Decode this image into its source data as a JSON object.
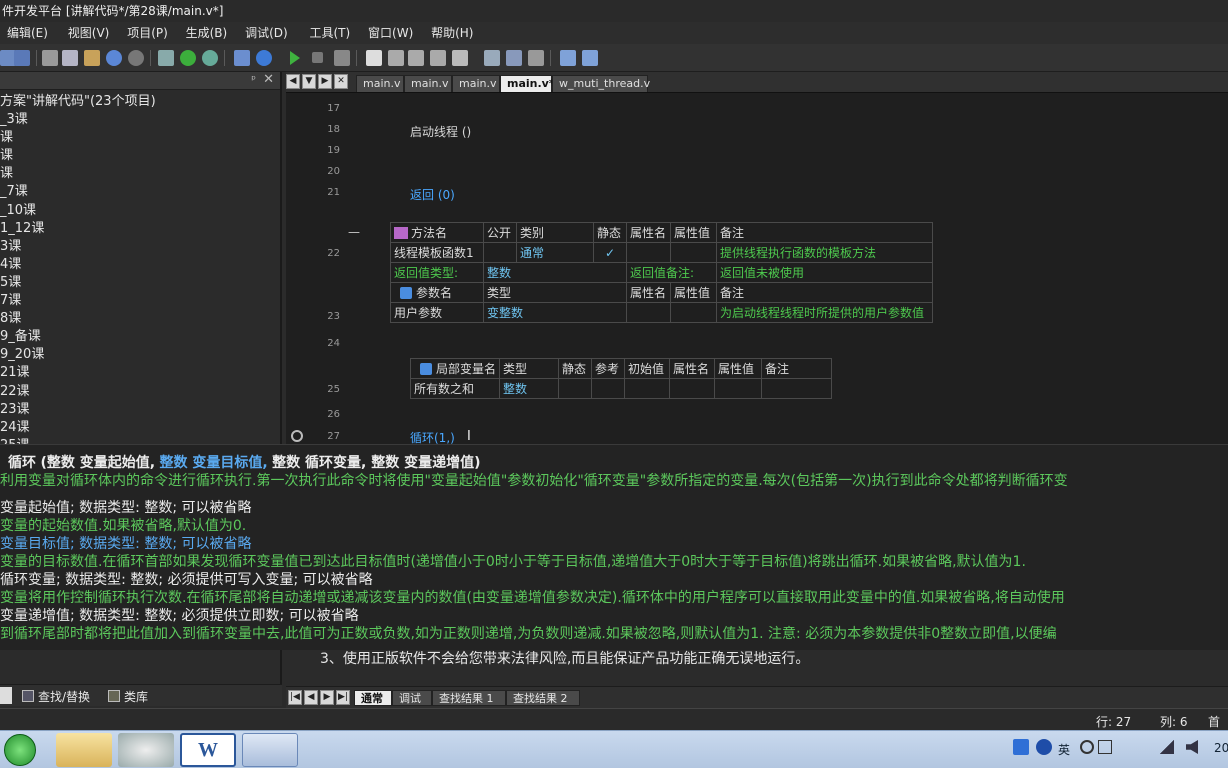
{
  "window": {
    "title": "件开发平台 [讲解代码*/第28课/main.v*]"
  },
  "menu": [
    "编辑(E)",
    "视图(V)",
    "项目(P)",
    "生成(B)",
    "调试(D)",
    "工具(T)",
    "窗口(W)",
    "帮助(H)"
  ],
  "solution_tree": {
    "items": [
      "方案\"讲解代码\"(23个项目)",
      "_3课",
      "课",
      "课",
      "课",
      "_7课",
      "_10课",
      "1_12课",
      "3课",
      "4课",
      "5课",
      "7课",
      "8课",
      "9_备课",
      "9_20课",
      "21课",
      "22课",
      "23课",
      "24课",
      "25课"
    ]
  },
  "left_tabs": [
    "查找/替换",
    "类库"
  ],
  "doc_tabs": {
    "items": [
      "main.v",
      "main.v",
      "main.v",
      "main.v*",
      "w_muti_thread.v"
    ],
    "active_index": 3
  },
  "editor": {
    "line17": "17",
    "line18": "18",
    "line18_code": "启动线程 ()",
    "line19": "19",
    "line20": "20",
    "line21": "21",
    "line21_code": "返回 (0)",
    "line22": "22",
    "line23": "23",
    "line24": "24",
    "line25": "25",
    "line26": "26",
    "line27": "27",
    "line27_code": "循环(1,)",
    "collapse_marker": "—",
    "cursor_glyph": "I",
    "method_table": {
      "headers": [
        "方法名",
        "公开",
        "类别",
        "静态",
        "属性名",
        "属性值",
        "备注"
      ],
      "row": [
        "线程模板函数1",
        "",
        "通常",
        "✓",
        "",
        "",
        "提供线程执行函数的模板方法"
      ],
      "return_type_label": "返回值类型:",
      "return_type": "整数",
      "return_note_label": "返回值备注:",
      "return_note": "返回值未被使用",
      "param_headers": [
        "参数名",
        "类型",
        "",
        "属性名",
        "属性值",
        "备注"
      ],
      "param_row": [
        "用户参数",
        "变整数",
        "",
        "",
        "",
        "为启动线程线程时所提供的用户参数值"
      ]
    },
    "local_table": {
      "headers": [
        "局部变量名",
        "类型",
        "静态",
        "参考",
        "初始值",
        "属性名",
        "属性值",
        "备注"
      ],
      "row": [
        "所有数之和",
        "整数",
        "",
        "",
        "",
        "",
        "",
        ""
      ]
    }
  },
  "help": {
    "signature_name": "循环",
    "signature_p1": "(整数 变量起始值,",
    "signature_p2": "整数 变量目标值,",
    "signature_p3": "整数 循环变量, 整数 变量递增值)",
    "desc": "利用变量对循环体内的命令进行循环执行.第一次执行此命令时将使用\"变量起始值\"参数初始化\"循环变量\"参数所指定的变量.每次(包括第一次)执行到此命令处都将判断循环变",
    "p1_title": "变量起始值; 数据类型: 整数; 可以被省略",
    "p1_desc": "变量的起始数值.如果被省略,默认值为0.",
    "p2_title": "变量目标值; 数据类型: 整数; 可以被省略",
    "p2_desc": "变量的目标数值.在循环首部如果发现循环变量值已到达此目标值时(递增值小于0时小于等于目标值,递增值大于0时大于等于目标值)将跳出循环.如果被省略,默认值为1.",
    "p3_title": "循环变量; 数据类型: 整数; 必须提供可写入变量; 可以被省略",
    "p3_desc": "变量将用作控制循环执行次数.在循环尾部将自动递增或递减该变量内的数值(由变量递增值参数决定).循环体中的用户程序可以直接取用此变量中的值.如果被省略,将自动使用",
    "p4_title": "变量递增值; 数据类型: 整数; 必须提供立即数; 可以被省略",
    "p4_desc": "到循环尾部时都将把此值加入到循环变量中去,此值可为正数或负数,如为正数则递增,为负数则递减.如果被忽略,则默认值为1. 注意: 必须为本参数提供非0整数立即值,以便编"
  },
  "output": {
    "line": "3、使用正版软件不会给您带来法律风险,而且能保证产品功能正确无误地运行。"
  },
  "bottom_tabs": {
    "items": [
      "通常",
      "调试",
      "查找结果 1",
      "查找结果 2"
    ],
    "active_index": 0
  },
  "status": {
    "row": "行: 27",
    "col": "列: 6",
    "extra": "首全"
  },
  "tray": {
    "ime": "英",
    "time": "20"
  }
}
